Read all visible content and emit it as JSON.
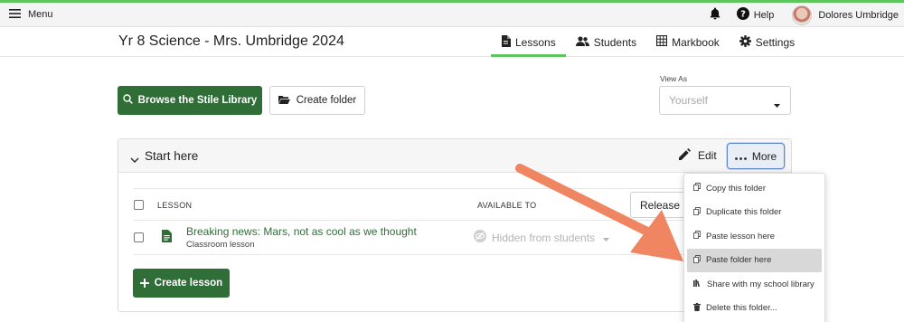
{
  "topbar": {
    "menu_label": "Menu",
    "help_label": "Help",
    "user_name": "Dolores Umbridge"
  },
  "header": {
    "course_title": "Yr 8 Science - Mrs. Umbridge 2024",
    "tabs": [
      {
        "label": "Lessons",
        "icon": "document-icon",
        "active": true
      },
      {
        "label": "Students",
        "icon": "people-icon",
        "active": false
      },
      {
        "label": "Markbook",
        "icon": "grid-icon",
        "active": false
      },
      {
        "label": "Settings",
        "icon": "gear-icon",
        "active": false
      }
    ]
  },
  "actions": {
    "browse_label": "Browse the Stile Library",
    "create_folder_label": "Create folder",
    "view_as_label": "View As",
    "view_as_value": "Yourself"
  },
  "folder": {
    "title": "Start here",
    "edit_label": "Edit",
    "more_label": "More",
    "columns": {
      "lesson": "LESSON",
      "available_to": "AVAILABLE TO"
    },
    "release_label": "Release all",
    "lessons": [
      {
        "title": "Breaking news: Mars, not as cool as we thought",
        "type": "Classroom lesson",
        "status": "Hidden from students"
      }
    ],
    "create_lesson_label": "Create lesson"
  },
  "more_menu": {
    "items": [
      {
        "label": "Copy this folder",
        "icon": "copy-icon",
        "highlighted": false
      },
      {
        "label": "Duplicate this folder",
        "icon": "copy-icon",
        "highlighted": false
      },
      {
        "label": "Paste lesson here",
        "icon": "paste-icon",
        "highlighted": false
      },
      {
        "label": "Paste folder here",
        "icon": "paste-icon",
        "highlighted": true
      },
      {
        "label": "Share with my school library",
        "icon": "library-icon",
        "highlighted": false
      },
      {
        "label": "Delete this folder...",
        "icon": "trash-icon",
        "highlighted": false
      }
    ]
  },
  "colors": {
    "brand_green": "#2f6e37",
    "accent_green": "#5cc65a",
    "arrow": "#f08561"
  }
}
